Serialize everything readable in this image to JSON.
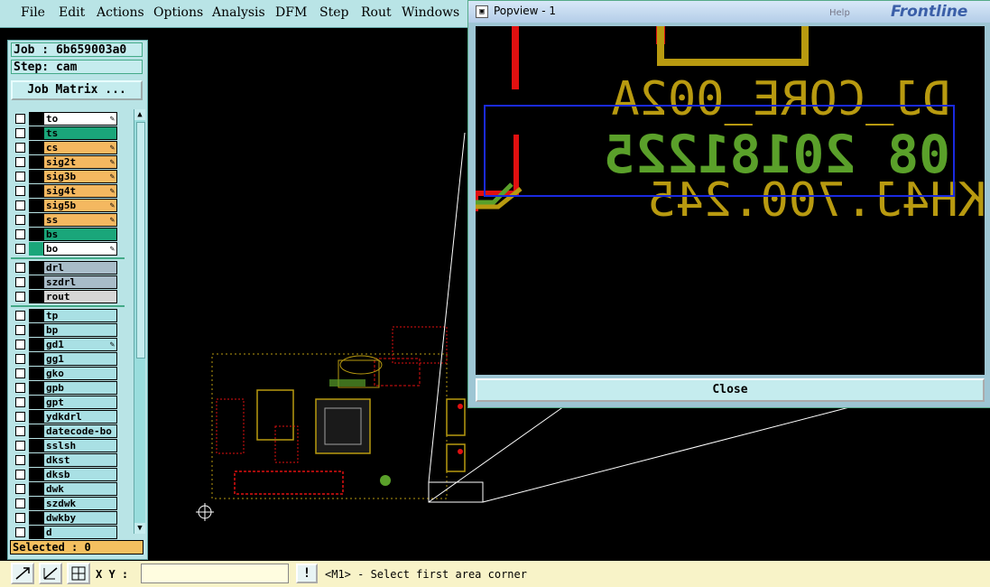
{
  "menu": [
    "File",
    "Edit",
    "Actions",
    "Options",
    "Analysis",
    "DFM",
    "Step",
    "Rout",
    "Windows"
  ],
  "job": {
    "label": "Job : 6b659003a0",
    "step": "Step: cam",
    "matrix_button": "Job Matrix ..."
  },
  "layers": [
    {
      "name": "to",
      "bg": "#ffffff",
      "swatch": "#000000",
      "editable": true
    },
    {
      "name": "ts",
      "bg": "#1aa67a",
      "swatch": "#000000",
      "editable": false
    },
    {
      "name": "cs",
      "bg": "#f4b860",
      "swatch": "#000000",
      "editable": true
    },
    {
      "name": "sig2t",
      "bg": "#f4b860",
      "swatch": "#000000",
      "editable": true
    },
    {
      "name": "sig3b",
      "bg": "#f4b860",
      "swatch": "#000000",
      "editable": true
    },
    {
      "name": "sig4t",
      "bg": "#f4b860",
      "swatch": "#000000",
      "editable": true
    },
    {
      "name": "sig5b",
      "bg": "#f4b860",
      "swatch": "#000000",
      "editable": true
    },
    {
      "name": "ss",
      "bg": "#f4b860",
      "swatch": "#000000",
      "editable": true
    },
    {
      "name": "bs",
      "bg": "#1aa67a",
      "swatch": "#000000",
      "editable": false
    },
    {
      "name": "bo",
      "bg": "#ffffff",
      "swatch": "#1aa67a",
      "editable": true
    },
    {
      "name": "drl",
      "bg": "#a8bcc8",
      "swatch": "#000000",
      "editable": false
    },
    {
      "name": "szdrl",
      "bg": "#a8bcc8",
      "swatch": "#000000",
      "editable": false
    },
    {
      "name": "rout",
      "bg": "#d6d6d6",
      "swatch": "#000000",
      "editable": false
    },
    {
      "name": "tp",
      "bg": "#a9e0e4",
      "swatch": "#000000",
      "editable": false
    },
    {
      "name": "bp",
      "bg": "#a9e0e4",
      "swatch": "#000000",
      "editable": false
    },
    {
      "name": "gd1",
      "bg": "#a9e0e4",
      "swatch": "#000000",
      "editable": true
    },
    {
      "name": "gg1",
      "bg": "#a9e0e4",
      "swatch": "#000000",
      "editable": false
    },
    {
      "name": "gko",
      "bg": "#a9e0e4",
      "swatch": "#000000",
      "editable": false
    },
    {
      "name": "gpb",
      "bg": "#a9e0e4",
      "swatch": "#000000",
      "editable": false
    },
    {
      "name": "gpt",
      "bg": "#a9e0e4",
      "swatch": "#000000",
      "editable": false
    },
    {
      "name": "ydkdrl",
      "bg": "#a9e0e4",
      "swatch": "#000000",
      "editable": false
    },
    {
      "name": "datecode-bo",
      "bg": "#a9e0e4",
      "swatch": "#000000",
      "editable": false
    },
    {
      "name": "sslsh",
      "bg": "#a9e0e4",
      "swatch": "#000000",
      "editable": false
    },
    {
      "name": "dkst",
      "bg": "#a9e0e4",
      "swatch": "#000000",
      "editable": false
    },
    {
      "name": "dksb",
      "bg": "#a9e0e4",
      "swatch": "#000000",
      "editable": false
    },
    {
      "name": "dwk",
      "bg": "#a9e0e4",
      "swatch": "#000000",
      "editable": false
    },
    {
      "name": "szdwk",
      "bg": "#a9e0e4",
      "swatch": "#000000",
      "editable": false
    },
    {
      "name": "dwkby",
      "bg": "#a9e0e4",
      "swatch": "#000000",
      "editable": false
    },
    {
      "name": "d",
      "bg": "#a9e0e4",
      "swatch": "#000000",
      "editable": false
    }
  ],
  "selected": "Selected : 0",
  "status": {
    "xy_label": "X Y :",
    "xy_value": "",
    "warn": "!",
    "message": "<M1> - Select first area corner"
  },
  "popview": {
    "title": "Popview - 1",
    "help": "Help",
    "brand": "Frontline",
    "close": "Close",
    "silkscreen_line1": "DJ_CORE_002A",
    "silkscreen_line2": "08 20181225",
    "silkscreen_line3": "KH4J.700.245"
  },
  "colors": {
    "silk": "#b89a10",
    "copper_green": "#5aa02a",
    "red": "#e01010",
    "selection_box": "#1a2ae0"
  }
}
